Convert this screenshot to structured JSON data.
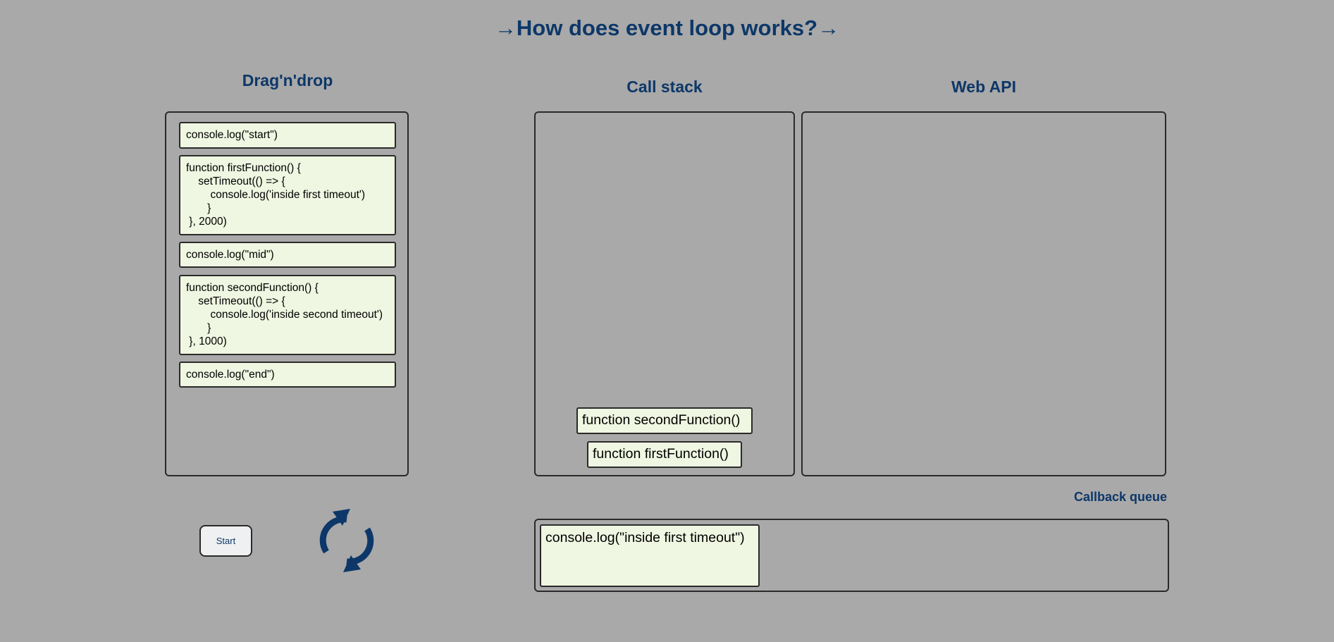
{
  "page": {
    "title": "→How does event loop works?→"
  },
  "dragdrop": {
    "heading": "Drag'n'drop",
    "blocks": [
      "console.log(\"start\")",
      "function firstFunction() {\n    setTimeout(() => {\n        console.log('inside first timeout')\n       }\n }, 2000)",
      "console.log(\"mid\")",
      "function secondFunction() {\n    setTimeout(() => {\n        console.log('inside second timeout')\n       }\n }, 1000)",
      "console.log(\"end\")"
    ]
  },
  "callstack": {
    "heading": "Call stack",
    "items": [
      "function secondFunction()",
      "function firstFunction()"
    ]
  },
  "webapi": {
    "heading": "Web API"
  },
  "callback_queue": {
    "heading": "Callback queue",
    "items": [
      "console.log(\"inside first timeout\")"
    ]
  },
  "controls": {
    "start_label": "Start",
    "refresh_icon": "refresh-icon"
  },
  "colors": {
    "background": "#a9a9a9",
    "heading": "#0d3768",
    "code_block_bg": "#eff6e1",
    "border": "#2a2a2a"
  }
}
